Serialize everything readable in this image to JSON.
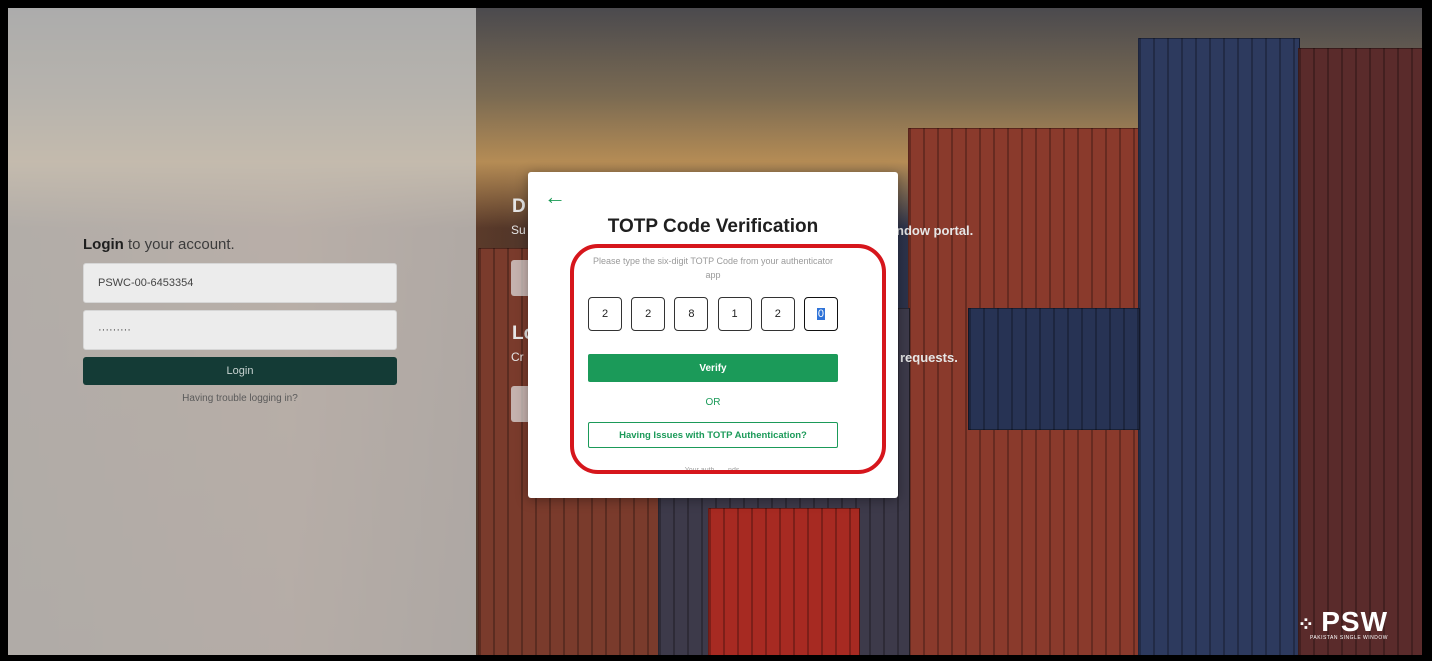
{
  "login": {
    "title_bold": "Login",
    "title_rest": " to your account.",
    "username": "PSWC-00-6453354",
    "password": "·········",
    "login_label": "Login",
    "trouble_label": "Having trouble logging in?"
  },
  "background": {
    "heading_1": "D",
    "sub_1": "Su",
    "portal_text": "ndow portal.",
    "heading_2": "Lo",
    "sub_2": "Cr",
    "requests_text": "requests."
  },
  "modal": {
    "back_icon": "←",
    "title": "TOTP Code Verification",
    "subtitle": "Please type the six-digit TOTP Code from your authenticator app",
    "code": [
      "2",
      "2",
      "8",
      "1",
      "2",
      "0"
    ],
    "verify_label": "Verify",
    "or_label": "OR",
    "issues_label": "Having Issues with TOTP Authentication?",
    "footer_note": "Your auth... ...nds."
  },
  "logo": {
    "name": "PSW",
    "tagline": "PAKISTAN SINGLE WINDOW"
  },
  "colors": {
    "accent": "#1b9a59",
    "highlight": "#d6161c",
    "login_button": "#143b36"
  }
}
